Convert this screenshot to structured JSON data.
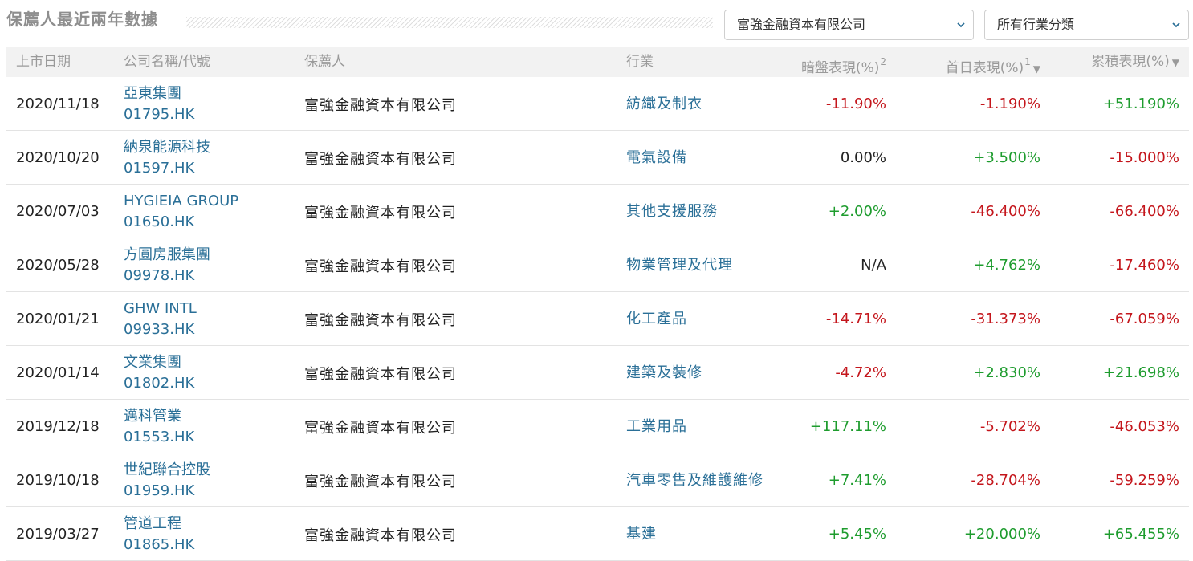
{
  "header": {
    "title": "保薦人最近兩年數據",
    "sponsor_select": "富強金融資本有限公司",
    "industry_select": "所有行業分類"
  },
  "table": {
    "columns": {
      "date": "上市日期",
      "company": "公司名稱/代號",
      "sponsor": "保薦人",
      "industry": "行業",
      "grey": "暗盤表現(%)",
      "grey_note": "2",
      "first": "首日表現(%)",
      "first_note": "1",
      "cum": "累積表現(%)"
    },
    "rows": [
      {
        "date": "2020/11/18",
        "name": "亞東集團",
        "code": "01795.HK",
        "sponsor": "富強金融資本有限公司",
        "industry": "紡織及制衣",
        "grey": "-11.90%",
        "grey_sign": "neg",
        "first": "-1.190%",
        "first_sign": "neg",
        "cum": "+51.190%",
        "cum_sign": "pos"
      },
      {
        "date": "2020/10/20",
        "name": "納泉能源科技",
        "code": "01597.HK",
        "sponsor": "富強金融資本有限公司",
        "industry": "電氣設備",
        "grey": "0.00%",
        "grey_sign": "zero",
        "first": "+3.500%",
        "first_sign": "pos",
        "cum": "-15.000%",
        "cum_sign": "neg"
      },
      {
        "date": "2020/07/03",
        "name": "HYGIEIA GROUP",
        "code": "01650.HK",
        "sponsor": "富強金融資本有限公司",
        "industry": "其他支援服務",
        "grey": "+2.00%",
        "grey_sign": "pos",
        "first": "-46.400%",
        "first_sign": "neg",
        "cum": "-66.400%",
        "cum_sign": "neg"
      },
      {
        "date": "2020/05/28",
        "name": "方圓房服集團",
        "code": "09978.HK",
        "sponsor": "富強金融資本有限公司",
        "industry": "物業管理及代理",
        "grey": "N/A",
        "grey_sign": "zero",
        "first": "+4.762%",
        "first_sign": "pos",
        "cum": "-17.460%",
        "cum_sign": "neg"
      },
      {
        "date": "2020/01/21",
        "name": "GHW INTL",
        "code": "09933.HK",
        "sponsor": "富強金融資本有限公司",
        "industry": "化工產品",
        "grey": "-14.71%",
        "grey_sign": "neg",
        "first": "-31.373%",
        "first_sign": "neg",
        "cum": "-67.059%",
        "cum_sign": "neg"
      },
      {
        "date": "2020/01/14",
        "name": "文業集團",
        "code": "01802.HK",
        "sponsor": "富強金融資本有限公司",
        "industry": "建築及裝修",
        "grey": "-4.72%",
        "grey_sign": "neg",
        "first": "+2.830%",
        "first_sign": "pos",
        "cum": "+21.698%",
        "cum_sign": "pos"
      },
      {
        "date": "2019/12/18",
        "name": "邁科管業",
        "code": "01553.HK",
        "sponsor": "富強金融資本有限公司",
        "industry": "工業用品",
        "grey": "+117.11%",
        "grey_sign": "pos",
        "first": "-5.702%",
        "first_sign": "neg",
        "cum": "-46.053%",
        "cum_sign": "neg"
      },
      {
        "date": "2019/10/18",
        "name": "世紀聯合控股",
        "code": "01959.HK",
        "sponsor": "富強金融資本有限公司",
        "industry": "汽車零售及維護維修",
        "grey": "+7.41%",
        "grey_sign": "pos",
        "first": "-28.704%",
        "first_sign": "neg",
        "cum": "-59.259%",
        "cum_sign": "neg"
      },
      {
        "date": "2019/03/27",
        "name": "管道工程",
        "code": "01865.HK",
        "sponsor": "富強金融資本有限公司",
        "industry": "基建",
        "grey": "+5.45%",
        "grey_sign": "pos",
        "first": "+20.000%",
        "first_sign": "pos",
        "cum": "+65.455%",
        "cum_sign": "pos"
      }
    ]
  },
  "icons": {
    "select_chevron": "chevron-down-icon",
    "sort": "sort-desc-icon"
  },
  "colors": {
    "negative": "#c4161c",
    "positive": "#1e9c2e",
    "link": "#2a6f97",
    "header_bg": "#f2f2f2"
  }
}
